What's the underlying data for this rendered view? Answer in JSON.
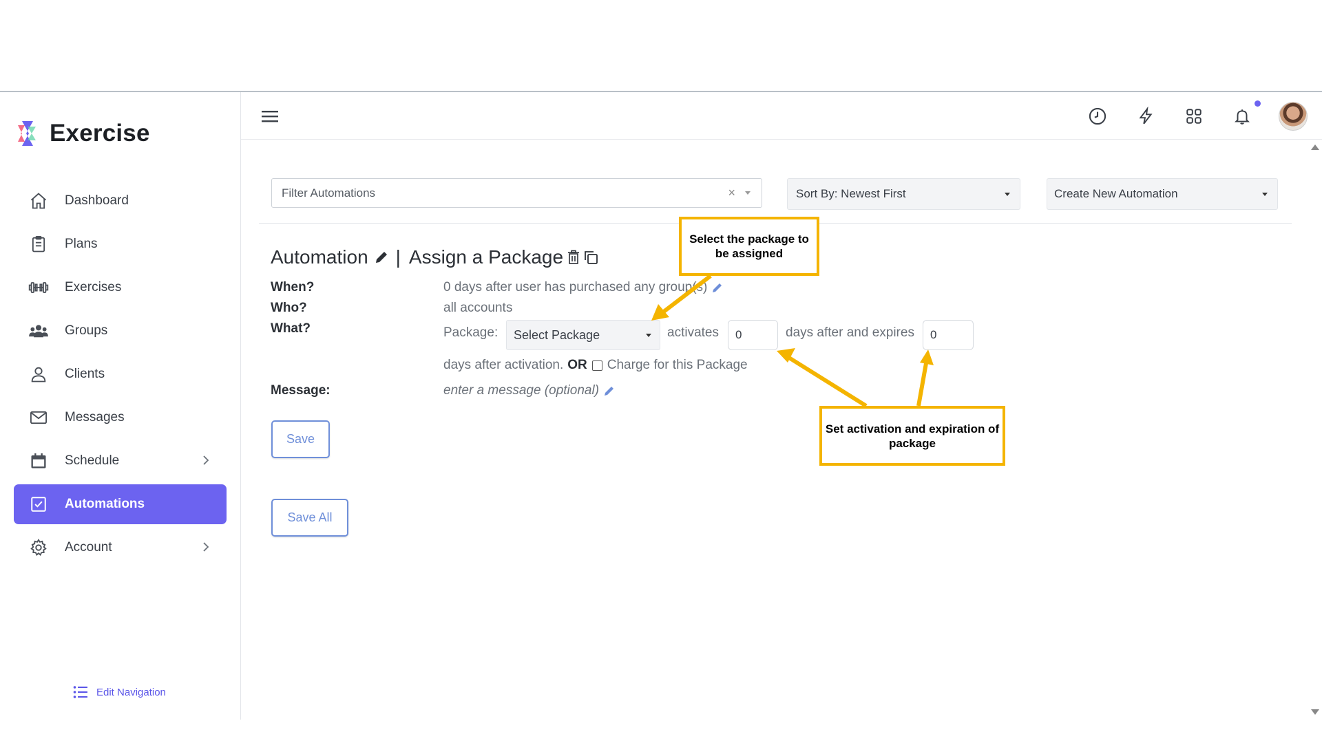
{
  "app": {
    "name": "Exercise"
  },
  "sidebar": {
    "items": [
      {
        "label": "Dashboard",
        "icon": "home-icon"
      },
      {
        "label": "Plans",
        "icon": "clipboard-icon"
      },
      {
        "label": "Exercises",
        "icon": "dumbbell-icon"
      },
      {
        "label": "Groups",
        "icon": "users-icon"
      },
      {
        "label": "Clients",
        "icon": "user-icon"
      },
      {
        "label": "Messages",
        "icon": "mail-icon"
      },
      {
        "label": "Schedule",
        "icon": "calendar-icon"
      },
      {
        "label": "Automations",
        "icon": "checkbox-icon",
        "active": true
      },
      {
        "label": "Account",
        "icon": "gear-icon"
      }
    ],
    "edit_nav_label": "Edit Navigation"
  },
  "header": {
    "icons": [
      "menu-icon",
      "clock-icon",
      "lightning-icon",
      "apps-grid-icon",
      "bell-icon",
      "avatar"
    ]
  },
  "toolbar": {
    "filter_placeholder": "Filter Automations",
    "sort_label": "Sort By: Newest First",
    "create_label": "Create New Automation"
  },
  "automation": {
    "title_prefix": "Automation",
    "separator": "|",
    "title_name": "Assign a Package",
    "when_label": "When?",
    "when_value": "0 days after user has purchased any group(s)",
    "who_label": "Who?",
    "who_value": "all accounts",
    "what_label": "What?",
    "package_label": "Package:",
    "package_select": "Select Package",
    "activates_label": "activates",
    "activates_value": "0",
    "expires_label": "days after and expires",
    "expires_value": "0",
    "after_activation": "days after activation.",
    "or_label": "OR",
    "charge_label": "Charge for this Package",
    "message_label": "Message:",
    "message_placeholder": "enter a message (optional)",
    "save_label": "Save",
    "save_all_label": "Save All"
  },
  "callouts": {
    "package": "Select the package to be assigned",
    "activation": "Set activation and expiration of package"
  },
  "colors": {
    "accent": "#6c63f0",
    "callout_border": "#f4b400",
    "link_blue": "#6f8fd9"
  }
}
